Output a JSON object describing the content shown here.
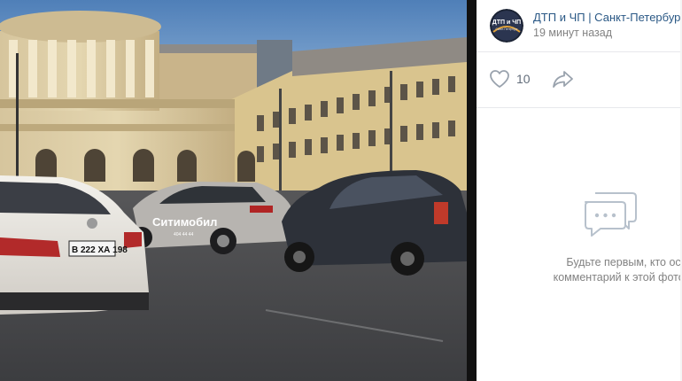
{
  "post": {
    "group_name": "ДТП и ЧП | Санкт-Петербург",
    "time": "19 минут назад",
    "avatar_text_top": "ДТП и ЧП",
    "avatar_text_bottom": "Санкт-Петербург"
  },
  "actions": {
    "likes": "10",
    "like_icon": "heart-icon",
    "share_icon": "share-arrow-icon"
  },
  "photo": {
    "car_branding": "Ситимобил",
    "car_branding_small": "404 44 44",
    "plate": "В 222 ХА 198"
  },
  "comments": {
    "empty_line1": "Будьте первым, кто оставит",
    "empty_line2": "комментарий к этой фотографии",
    "icon": "comments-icon"
  },
  "colors": {
    "link": "#2a5885",
    "muted": "#828282",
    "divider": "#e7e8ec",
    "icon_gray": "#99a2ad"
  }
}
